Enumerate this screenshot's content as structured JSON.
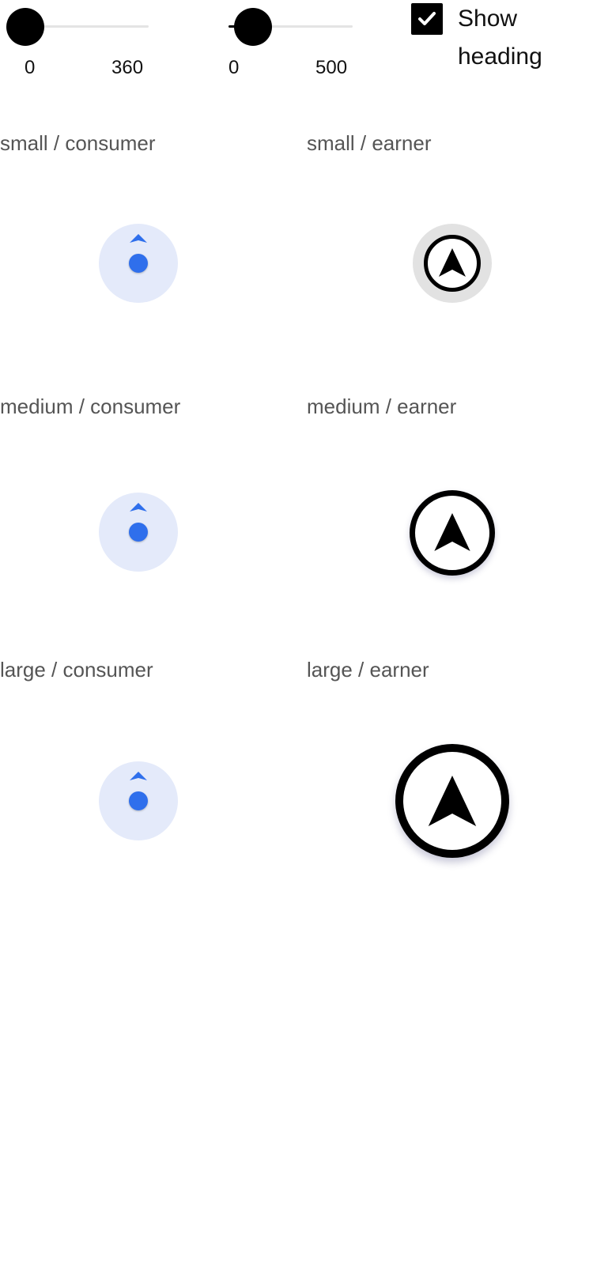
{
  "controls": {
    "heading_slider": {
      "min_label": "0",
      "max_label": "360",
      "min": 0,
      "max": 360,
      "value": 0
    },
    "second_slider": {
      "min_label": "0",
      "max_label": "500",
      "min": 0,
      "max": 500,
      "value": 0
    },
    "show_heading": {
      "label": "Show heading",
      "checked": true
    }
  },
  "cells": {
    "small_consumer": {
      "label": "small / consumer"
    },
    "small_earner": {
      "label": "small / earner"
    },
    "medium_consumer": {
      "label": "medium / consumer"
    },
    "medium_earner": {
      "label": "medium / earner"
    },
    "large_consumer": {
      "label": "large / consumer"
    },
    "large_earner": {
      "label": "large / earner"
    }
  },
  "icons": {
    "consumer_marker": "location-dot-icon",
    "earner_marker": "navigation-arrow-icon",
    "checkbox": "check-icon"
  },
  "colors": {
    "consumer_blue": "#2f6fec",
    "consumer_halo": "#e4eafa",
    "earner_black": "#000000",
    "earner_halo": "#e2e2e2",
    "label_gray": "#555555"
  }
}
